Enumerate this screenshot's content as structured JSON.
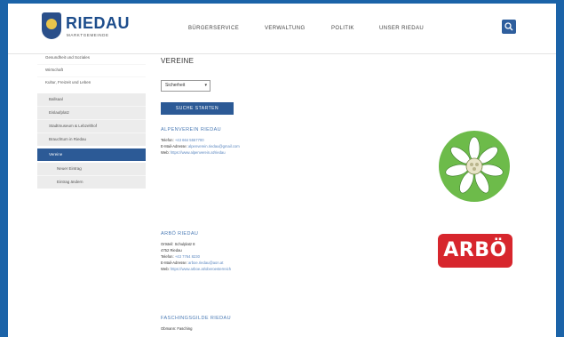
{
  "brand": {
    "name": "RIEDAU",
    "subtitle": "MARKTGEMEINDE"
  },
  "nav": {
    "items": [
      "BÜRGERSERVICE",
      "VERWALTUNG",
      "POLITIK",
      "UNSER RIEDAU"
    ]
  },
  "sidebar": {
    "items": [
      {
        "label": "Gesundheit und Soziales"
      },
      {
        "label": "Wirtschaft"
      },
      {
        "label": "Kultur, Freizeit und Leben"
      },
      {
        "label": "Ballsaal"
      },
      {
        "label": "Eislaufplatz"
      },
      {
        "label": "Stadtmuseum & Lebzelthof"
      },
      {
        "label": "Brauchtum in Riedau"
      },
      {
        "label": "Vereine"
      },
      {
        "label": "Neuer Eintrag"
      },
      {
        "label": "Eintrag ändern"
      }
    ]
  },
  "main": {
    "title": "VEREINE",
    "select": {
      "value": "Sicherheit"
    },
    "submit_label": "SUCHE STARTEN",
    "entries": [
      {
        "name": "ALPENVEREIN RIEDAU",
        "lines": [
          {
            "label": "Telefon:",
            "value": "+43 664 5557700"
          },
          {
            "label": "E-Mail-Adresse:",
            "value": "alpenverein.riedau@gmail.com"
          },
          {
            "label": "Web:",
            "value": "https://www.alpenverein.at/riedau"
          }
        ]
      },
      {
        "name": "ARBÖ RIEDAU",
        "lines": [
          {
            "label": "Ortsteil:",
            "value": "Schulplatz 8"
          },
          {
            "label": "",
            "value": "4752 Riedau"
          },
          {
            "label": "Telefon:",
            "value": "+43 7764 8230"
          },
          {
            "label": "E-Mail-Adresse:",
            "value": "arboe.riedau@aon.at"
          },
          {
            "label": "Web:",
            "value": "https://www.arboe.at/oberoesterreich"
          }
        ]
      },
      {
        "name": "FASCHINGSGILDE RIEDAU",
        "lines": [
          {
            "label": "Obmann:",
            "value": "Fasching"
          }
        ]
      }
    ]
  },
  "logos": {
    "arbo_text": "ARBÖ",
    "arbo_color": "#d7262d",
    "alpen_color": "#6dbb4a"
  },
  "colors": {
    "accent": "#2c5a96",
    "frame": "#1b63a8",
    "link": "#4a7ab5"
  }
}
